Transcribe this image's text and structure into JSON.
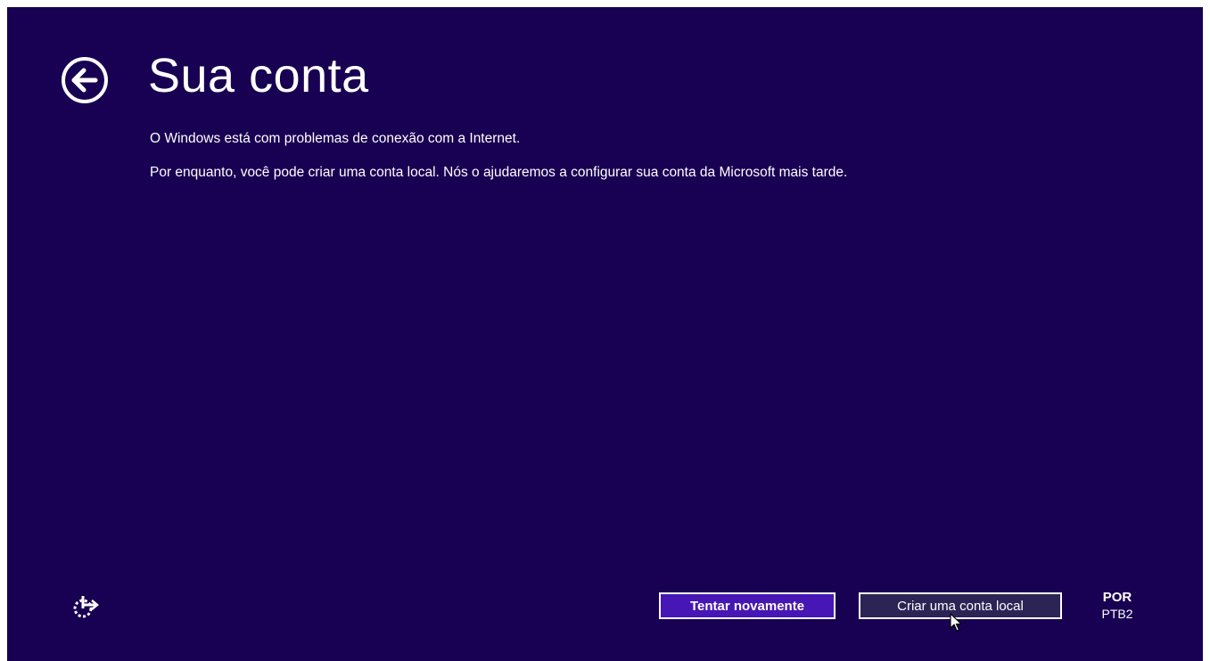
{
  "page": {
    "title": "Sua conta",
    "messages": {
      "line1": "O Windows está com problemas de conexão com a Internet.",
      "line2": "Por enquanto, você pode criar uma conta local. Nós o ajudaremos a configurar sua conta da Microsoft mais tarde."
    }
  },
  "footer": {
    "retry_button": "Tentar novamente",
    "local_account_button": "Criar uma conta local",
    "language": {
      "code": "POR",
      "layout": "PTB2"
    }
  },
  "icons": {
    "back": "back-arrow-icon",
    "ease_of_access": "ease-of-access-icon",
    "cursor": "mouse-pointer-icon"
  },
  "colors": {
    "background": "#180052",
    "primary_button": "#4617b4",
    "secondary_button": "#2d2456",
    "text": "#ffffff"
  }
}
